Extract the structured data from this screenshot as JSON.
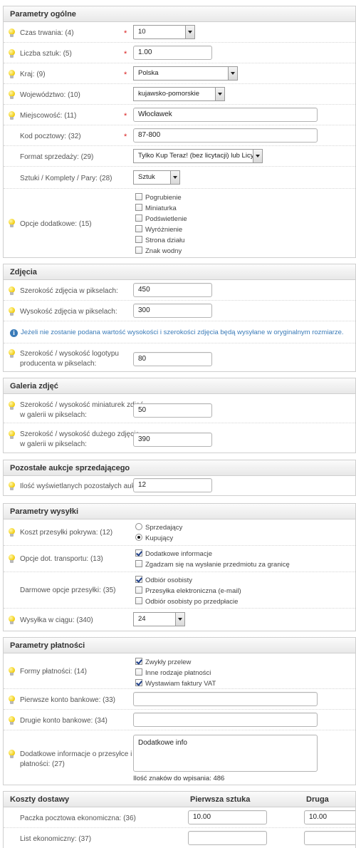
{
  "general": {
    "title": "Parametry ogólne",
    "duration": {
      "label": "Czas trwania: (4)",
      "value": "10"
    },
    "quantity": {
      "label": "Liczba sztuk: (5)",
      "value": "1.00"
    },
    "country": {
      "label": "Kraj: (9)",
      "value": "Polska"
    },
    "region": {
      "label": "Województwo: (10)",
      "value": "kujawsko-pomorskie"
    },
    "city": {
      "label": "Miejscowość: (11)",
      "value": "Włocławek"
    },
    "postcode": {
      "label": "Kod pocztowy: (32)",
      "value": "87-800"
    },
    "sale_format": {
      "label": "Format sprzedaży: (29)",
      "value": "Tylko Kup Teraz! (bez licytacji) lub Licytacja"
    },
    "units": {
      "label": "Sztuki / Komplety / Pary: (28)",
      "value": "Sztuk"
    },
    "extra_options": {
      "label": "Opcje dodatkowe: (15)",
      "options": [
        "Pogrubienie",
        "Miniaturka",
        "Podświetlenie",
        "Wyróżnienie",
        "Strona działu",
        "Znak wodny"
      ]
    },
    "required_mark": "*"
  },
  "photos": {
    "title": "Zdjęcia",
    "width": {
      "label": "Szerokość zdjęcia w pikselach:",
      "value": "450"
    },
    "height": {
      "label": "Wysokość zdjęcia w pikselach:",
      "value": "300"
    },
    "info": "Jeżeli nie zostanie podana wartość wysokości i szerokości zdjęcia będą wysyłane w oryginalnym rozmiarze.",
    "logo": {
      "label_line1": "Szerokość / wysokość logotypu",
      "label_line2": "producenta w pikselach:",
      "value": "80"
    }
  },
  "gallery": {
    "title": "Galeria zdjęć",
    "thumbs": {
      "label_line1": "Szerokość / wysokość miniaturek zdjęć",
      "label_line2": "w galerii w pikselach:",
      "value": "50"
    },
    "big": {
      "label_line1": "Szerokość / wysokość dużego zdjęcia",
      "label_line2": "w galerii w pikselach:",
      "value": "390"
    }
  },
  "other": {
    "title": "Pozostałe aukcje sprzedającego",
    "count": {
      "label": "Ilość wyświetlanych pozostałych aukcji:",
      "value": "12"
    }
  },
  "shipping": {
    "title": "Parametry wysyłki",
    "cost_payer": {
      "label": "Koszt przesyłki pokrywa: (12)",
      "options": [
        "Sprzedający",
        "Kupujący"
      ],
      "selected": "Kupujący"
    },
    "transport": {
      "label": "Opcje dot. transportu: (13)",
      "options": [
        "Dodatkowe informacje",
        "Zgadzam się na wysłanie przedmiotu za granicę"
      ]
    },
    "free": {
      "label": "Darmowe opcje przesyłki: (35)",
      "options": [
        "Odbiór osobisty",
        "Przesyłka elektroniczna (e-mail)",
        "Odbiór osobisty po przedpłacie"
      ]
    },
    "dispatch": {
      "label": "Wysyłka w ciągu: (340)",
      "value": "24"
    }
  },
  "payment": {
    "title": "Parametry płatności",
    "forms": {
      "label": "Formy płatności: (14)",
      "options": [
        "Zwykły przelew",
        "Inne rodzaje płatności",
        "Wystawiam faktury VAT"
      ]
    },
    "account1": {
      "label": "Pierwsze konto bankowe: (33)",
      "value": ""
    },
    "account2": {
      "label": "Drugie konto bankowe: (34)",
      "value": ""
    },
    "extra": {
      "label_line1": "Dodatkowe informacje o przesyłce i",
      "label_line2": "płatności: (27)",
      "value": "Dodatkowe info",
      "counter_label": "Ilość znaków do wpisania:",
      "counter_value": "486"
    }
  },
  "delivery": {
    "title": "Koszty dostawy",
    "col1": "Pierwsza sztuka",
    "col2": "Druga sztuka",
    "rows": [
      {
        "label": "Paczka pocztowa ekonomiczna: (36)",
        "first": "10.00",
        "second": "10.00"
      },
      {
        "label": "List ekonomiczny: (37)",
        "first": "",
        "second": ""
      }
    ]
  }
}
